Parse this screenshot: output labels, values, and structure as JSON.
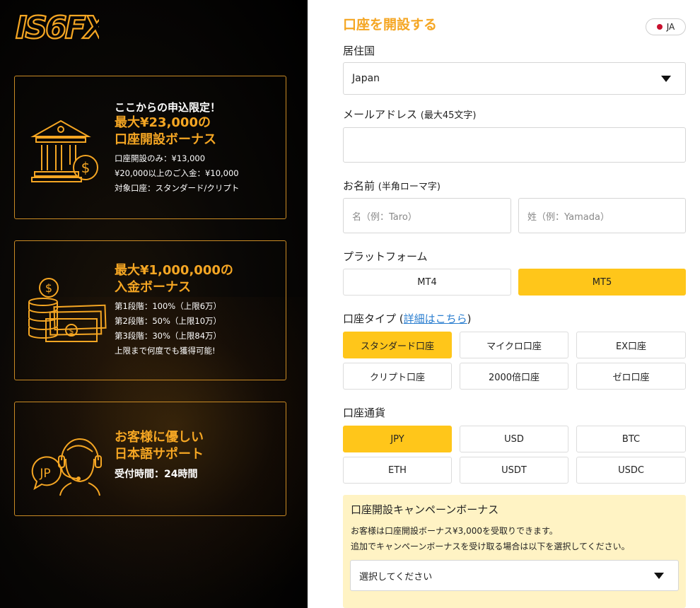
{
  "brand": {
    "logo": "IS6FX",
    "accent": "#f5a623",
    "highlight": "#ffc61a"
  },
  "promo": {
    "card1": {
      "pre": "ここからの申込限定！",
      "headline1": "最大¥23,000の",
      "headline2": "口座開設ボーナス",
      "details": [
        "口座開設のみ：¥13,000",
        "¥20,000以上のご入金：¥10,000",
        "対象口座：スタンダード/クリプト"
      ],
      "icon": "bank-coin-icon"
    },
    "card2": {
      "headline1": "最大¥1,000,000の",
      "headline2": "入金ボーナス",
      "details": [
        "第1段階：100%（上限6万）",
        "第2段階：50%（上限10万）",
        "第3段階：30%（上限84万）",
        "上限まで何度でも獲得可能!"
      ],
      "icon": "coins-cash-icon"
    },
    "card3": {
      "headline1": "お客様に優しい",
      "headline2": "日本語サポート",
      "detail": "受付時間：24時間",
      "badge": "JP",
      "icon": "support-agent-icon"
    }
  },
  "form": {
    "title": "口座を開設する",
    "language": "JA",
    "residence": {
      "label": "居住国",
      "value": "Japan"
    },
    "email": {
      "label": "メールアドレス",
      "hint": "(最大45文字)",
      "value": ""
    },
    "name": {
      "label": "お名前",
      "hint": "(半角ローマ字)",
      "first_placeholder": "名（例：Taro）",
      "last_placeholder": "姓（例：Yamada）"
    },
    "platform": {
      "label": "プラットフォーム",
      "options": [
        "MT4",
        "MT5"
      ],
      "selected": "MT5"
    },
    "account_type": {
      "label": "口座タイプ",
      "link_open": "(",
      "link": "詳細はこちら",
      "link_close": ")",
      "options": [
        "スタンダード口座",
        "マイクロ口座",
        "EX口座",
        "クリプト口座",
        "2000倍口座",
        "ゼロ口座"
      ],
      "selected": "スタンダード口座"
    },
    "currency": {
      "label": "口座通貨",
      "options": [
        "JPY",
        "USD",
        "BTC",
        "ETH",
        "USDT",
        "USDC"
      ],
      "selected": "JPY"
    },
    "campaign": {
      "title": "口座開設キャンペーンボーナス",
      "line1": "お客様は口座開設ボーナス¥3,000を受取りできます。",
      "line2": "追加でキャンペーンボーナスを受け取る場合は以下を選択してください。",
      "select_value": "選択してください"
    }
  }
}
